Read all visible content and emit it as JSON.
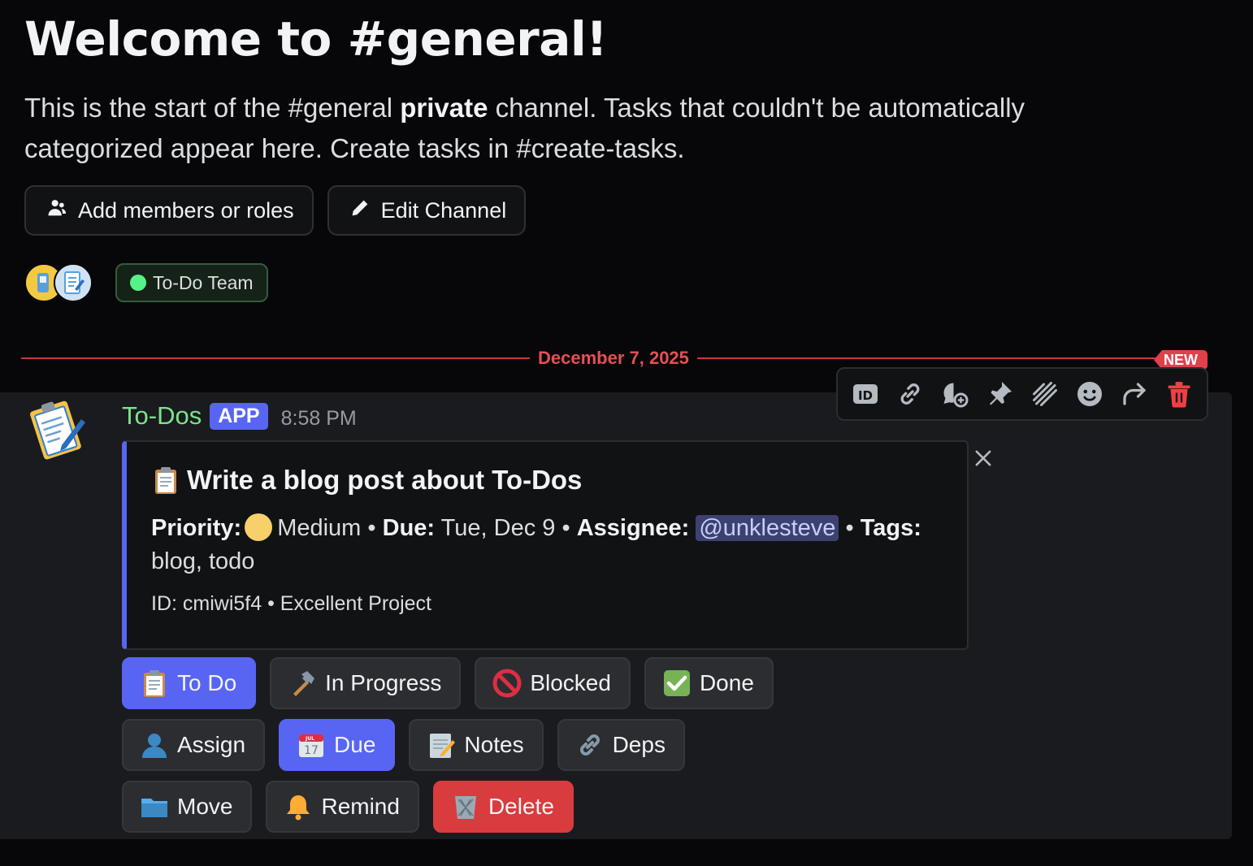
{
  "channel": {
    "title": "Welcome to #general!",
    "intro_prefix": "This is the start of the #general ",
    "intro_bold": "private",
    "intro_suffix": " channel. Tasks that couldn't be automatically categorized appear here. Create tasks in #create-tasks."
  },
  "buttons": {
    "add_members": "Add members or roles",
    "edit_channel": "Edit Channel"
  },
  "role": {
    "name": "To-Do Team",
    "color": "#57f287"
  },
  "divider": {
    "date": "December 7, 2025",
    "badge": "NEW"
  },
  "message": {
    "author": "To-Dos",
    "tag": "APP",
    "time": "8:58 PM",
    "embed": {
      "title": "Write a blog post about To-Dos",
      "priority_label": "Priority:",
      "priority_value": "Medium",
      "due_label": "Due:",
      "due_value": "Tue, Dec 9",
      "assignee_label": "Assignee:",
      "assignee_value": "@unklesteve",
      "tags_label": "Tags:",
      "tags_value": "blog, todo",
      "separator": "•",
      "footer": "ID: cmiwi5f4 • Excellent Project"
    }
  },
  "toolbar_icons": [
    "id-icon",
    "link-icon",
    "thread-icon",
    "pin-icon",
    "reaction-burst-icon",
    "emoji-icon",
    "forward-icon",
    "trash-icon"
  ],
  "actions": {
    "row1": [
      "To Do",
      "In Progress",
      "Blocked",
      "Done"
    ],
    "row2": [
      "Assign",
      "Due",
      "Notes",
      "Deps"
    ],
    "row3": [
      "Move",
      "Remind",
      "Delete"
    ]
  },
  "colors": {
    "accent": "#5865f2",
    "danger": "#d83c3e",
    "author": "#7ce38b",
    "divider": "#e55050"
  }
}
